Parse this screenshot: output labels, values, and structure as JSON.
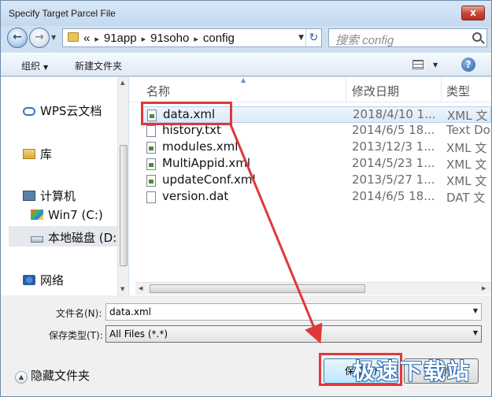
{
  "window": {
    "title": "Specify Target Parcel File",
    "close_label": "x"
  },
  "address": {
    "breadcrumbs": [
      "«",
      "91app",
      "91soho",
      "config"
    ],
    "search_placeholder": "搜索 config"
  },
  "toolbar": {
    "organize_label": "组织",
    "new_folder_label": "新建文件夹"
  },
  "nav": {
    "items": [
      {
        "label": "WPS云文档",
        "icon": "cloud-icon"
      },
      {
        "label": "库",
        "icon": "library-icon"
      },
      {
        "label": "计算机",
        "icon": "computer-icon"
      },
      {
        "label": "Win7 (C:)",
        "icon": "windows-drive-icon"
      },
      {
        "label": "本地磁盘 (D:",
        "icon": "drive-icon",
        "selected": true
      },
      {
        "label": "网络",
        "icon": "network-icon"
      }
    ]
  },
  "files": {
    "columns": {
      "name": "名称",
      "date": "修改日期",
      "type": "类型"
    },
    "rows": [
      {
        "name": "data.xml",
        "date": "2018/4/10 1...",
        "type": "XML 文",
        "icon": "xml-file-icon",
        "selected": true
      },
      {
        "name": "history.txt",
        "date": "2014/6/5 18...",
        "type": "Text Do",
        "icon": "text-file-icon"
      },
      {
        "name": "modules.xml",
        "date": "2013/12/3 1...",
        "type": "XML 文",
        "icon": "xml-file-icon"
      },
      {
        "name": "MultiAppid.xml",
        "date": "2014/5/23 1...",
        "type": "XML 文",
        "icon": "xml-file-icon"
      },
      {
        "name": "updateConf.xml",
        "date": "2013/5/27 1...",
        "type": "XML 文",
        "icon": "xml-file-icon"
      },
      {
        "name": "version.dat",
        "date": "2014/6/5 18...",
        "type": "DAT 文",
        "icon": "file-icon"
      }
    ]
  },
  "form": {
    "filename_label": "文件名(N):",
    "filename_value": "data.xml",
    "filetype_label": "保存类型(T):",
    "filetype_value": "All Files (*.*)"
  },
  "footer": {
    "hide_folders_label": "隐藏文件夹",
    "save_label": "保存(S)",
    "cancel_label": "取消"
  },
  "watermark": "极速下载站",
  "colors": {
    "annotation": "#e0383a",
    "selection": "#dce9f8",
    "title_bar": "#c4d8ee"
  }
}
